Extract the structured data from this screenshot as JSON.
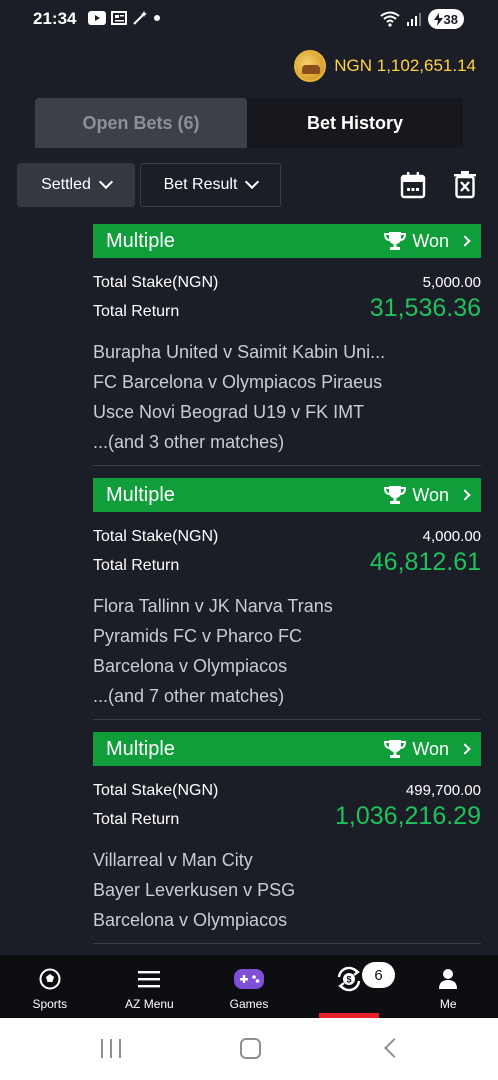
{
  "status_bar": {
    "time": "21:34",
    "battery": "38"
  },
  "header": {
    "balance": "NGN 1,102,651.14"
  },
  "tabs": [
    {
      "label": "Open Bets (6)",
      "active": false
    },
    {
      "label": "Bet History",
      "active": true
    }
  ],
  "filters": {
    "settled_label": "Settled",
    "result_label": "Bet Result"
  },
  "bets": [
    {
      "type": "Multiple",
      "status": "Won",
      "stake_label": "Total Stake(NGN)",
      "stake": "5,000.00",
      "return_label": "Total Return",
      "return": "31,536.36",
      "matches": [
        "Burapha United v Saimit Kabin Uni...",
        "FC Barcelona v Olympiacos Piraeus",
        "Usce Novi Beograd U19 v FK IMT",
        "...(and 3 other matches)"
      ]
    },
    {
      "type": "Multiple",
      "status": "Won",
      "stake_label": "Total Stake(NGN)",
      "stake": "4,000.00",
      "return_label": "Total Return",
      "return": "46,812.61",
      "matches": [
        "Flora Tallinn v JK Narva Trans",
        "Pyramids FC v Pharco FC",
        "Barcelona v Olympiacos",
        "...(and 7 other matches)"
      ]
    },
    {
      "type": "Multiple",
      "status": "Won",
      "stake_label": "Total Stake(NGN)",
      "stake": "499,700.00",
      "return_label": "Total Return",
      "return": "1,036,216.29",
      "matches": [
        "Villarreal v Man City",
        "Bayer Leverkusen v PSG",
        "Barcelona v Olympiacos"
      ]
    }
  ],
  "bottom_nav": {
    "items": [
      {
        "label": "Sports",
        "icon": "soccer-ball-icon"
      },
      {
        "label": "AZ Menu",
        "icon": "hamburger-menu-icon"
      },
      {
        "label": "Games",
        "icon": "gamepad-icon"
      },
      {
        "label": "",
        "icon": "bets-cashout-icon"
      },
      {
        "label": "Me",
        "icon": "user-icon"
      }
    ],
    "badge": "6"
  },
  "colors": {
    "won_green": "#109e3a",
    "return_green": "#1fc15c",
    "balance_yellow": "#ffd23e",
    "active_red": "#e8202e"
  }
}
